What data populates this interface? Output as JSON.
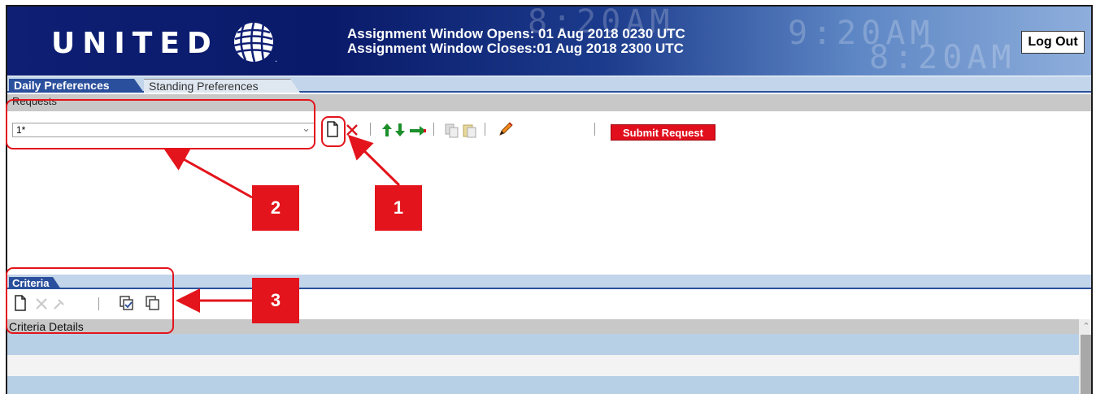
{
  "header": {
    "logo_text": "UNITED",
    "assignment_opens": "Assignment Window Opens: 01 Aug 2018 0230 UTC",
    "assignment_closes": "Assignment Window Closes:01 Aug 2018 2300 UTC",
    "logout_label": "Log Out"
  },
  "tabs": [
    {
      "label": "Daily Preferences",
      "active": true
    },
    {
      "label": "Standing Preferences",
      "active": false
    }
  ],
  "requests": {
    "section_label": "Requests",
    "selected_request": "1*",
    "toolbar_icons": [
      "new-document-icon",
      "delete-icon",
      "move-up-icon",
      "move-down-icon",
      "move-to-icon",
      "copy-icon",
      "paste-icon",
      "edit-pencil-icon"
    ],
    "submit_label": "Submit Request"
  },
  "criteria": {
    "tab_label": "Criteria",
    "toolbar_icons": [
      "new-document-icon",
      "delete-icon",
      "tools-icon",
      "select-all-icon",
      "copy-criteria-icon"
    ],
    "details_header": "Criteria Details"
  },
  "annotations": [
    "1",
    "2",
    "3"
  ],
  "colors": {
    "brand_navy": "#0e1f74",
    "tab_blue": "#2a4f9c",
    "accent_red": "#e10f1c",
    "arrow_green": "#1c8f2b",
    "row_blue": "#b8d0e6"
  }
}
